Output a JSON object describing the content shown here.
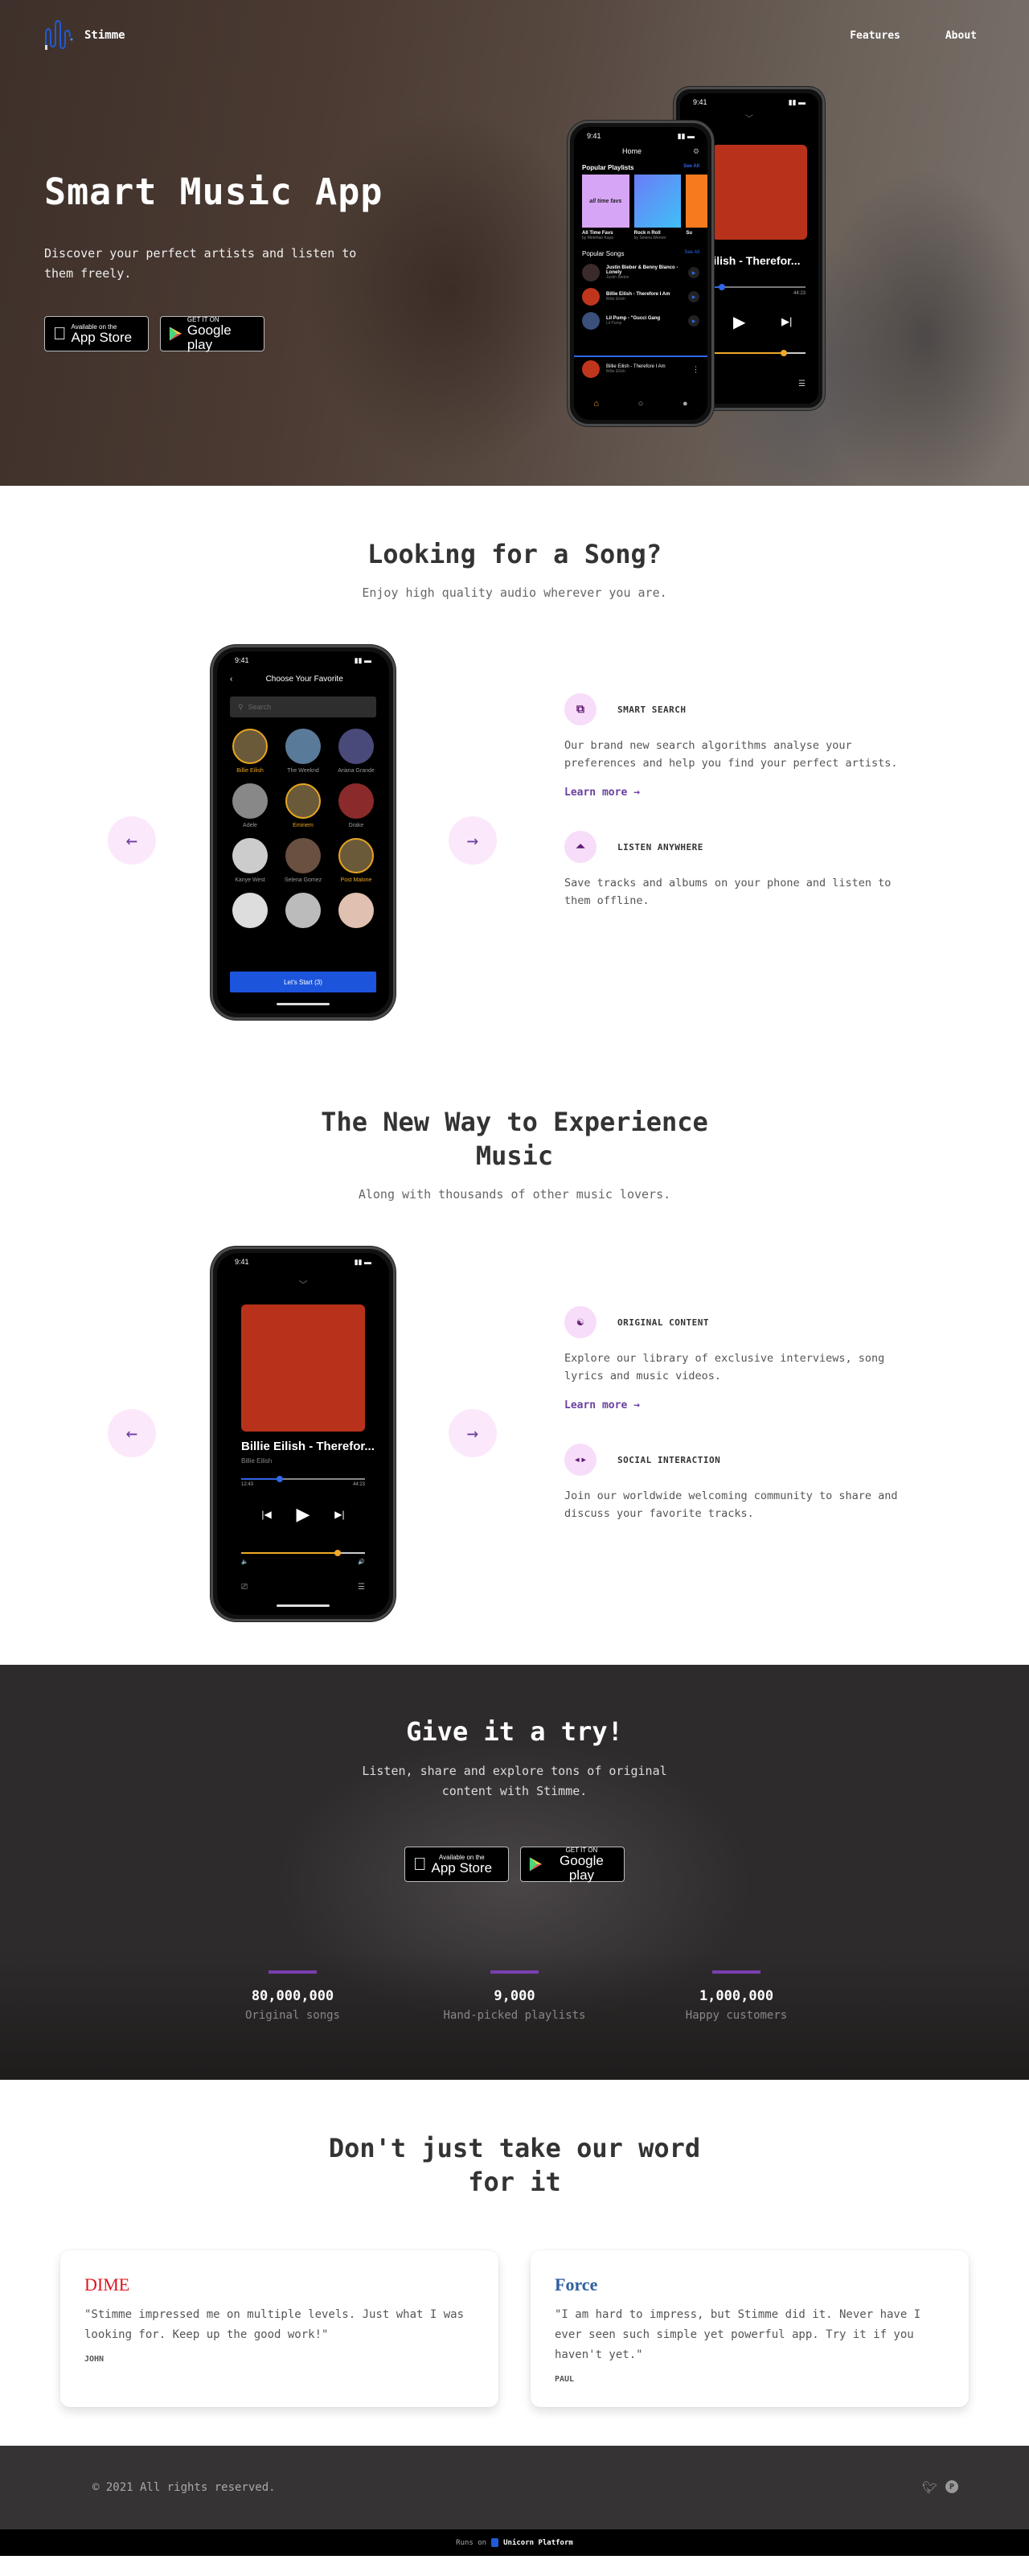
{
  "brand": {
    "name": "Stimme",
    "logo_icon": "sound-wave-icon",
    "accent": "#1e5bd8"
  },
  "nav": {
    "items": [
      {
        "label": "Features"
      },
      {
        "label": "About"
      }
    ]
  },
  "hero": {
    "title": "Smart Music App",
    "subtitle": "Discover your perfect artists and listen to them freely.",
    "appstore": {
      "small": "Available on the",
      "big": "App Store",
      "icon": "apple-icon"
    },
    "googleplay": {
      "small": "GET IT ON",
      "big": "Google play",
      "icon": "play-triangle-icon"
    },
    "phone_home": {
      "time": "9:41",
      "title": "Home",
      "playlists_heading": "Popular Playlists",
      "see_all": "See All",
      "playlists": [
        {
          "name": "All Time Favs",
          "by": "by Metehan Kaya",
          "cover_text": "all time favs",
          "color": "#d7a5f5"
        },
        {
          "name": "Rock n Roll",
          "by": "by Selena Werner",
          "color": "#3fa2f7"
        },
        {
          "name": "Su",
          "by": "by",
          "color": "#f77a1e"
        }
      ],
      "songs_heading": "Popular Songs",
      "songs": [
        {
          "title": "Justin Bieber & Benny Blanco - Lonely",
          "artist": "Justin Bieber"
        },
        {
          "title": "Billie Eilish - Therefore I Am",
          "artist": "Billie Eilish"
        },
        {
          "title": "Lil Pump - \"Gucci Gang",
          "artist": "Lil Pump"
        }
      ],
      "now_playing": {
        "title": "Billie Eilish - Therefore I Am",
        "artist": "Billie Eilish"
      }
    },
    "phone_player": {
      "time": "9:41",
      "title": "Eilish - Therefor...",
      "end_time": "44:23"
    }
  },
  "section1": {
    "title": "Looking for a Song?",
    "subtitle": "Enjoy high quality audio wherever you are.",
    "phone": {
      "time": "9:41",
      "header": "Choose Your Favorite",
      "search_placeholder": "Search",
      "artists": [
        {
          "name": "Billie Eilish",
          "selected": true
        },
        {
          "name": "The Weeknd",
          "selected": false
        },
        {
          "name": "Ariana Grande",
          "selected": false
        },
        {
          "name": "Adele",
          "selected": false
        },
        {
          "name": "Eminem",
          "selected": true
        },
        {
          "name": "Drake",
          "selected": false
        },
        {
          "name": "Kanye West",
          "selected": false
        },
        {
          "name": "Selena Gomez",
          "selected": false
        },
        {
          "name": "Post Malone",
          "selected": true
        },
        {
          "name": "",
          "selected": false
        },
        {
          "name": "",
          "selected": false
        },
        {
          "name": "",
          "selected": false
        }
      ],
      "start_button": "Let's Start (3)"
    },
    "features": [
      {
        "icon": "puzzle-icon",
        "title": "SMART SEARCH",
        "text": "Our brand new search algorithms analyse your preferences and help you find your perfect artists.",
        "link": "Learn more →"
      },
      {
        "icon": "double-chevron-up-icon",
        "title": "LISTEN ANYWHERE",
        "text": "Save tracks and albums on your phone and listen to them offline."
      }
    ]
  },
  "section2": {
    "title": "The New Way to Experience Music",
    "subtitle": "Along with thousands of other music lovers.",
    "phone": {
      "time": "9:41",
      "song_title": "Billie Eilish - Therefor...",
      "artist": "Billie Eilish",
      "elapsed": "12:43",
      "total": "44:23",
      "progress_fraction": 0.31,
      "volume_fraction": 0.78
    },
    "features": [
      {
        "icon": "yin-yang-icon",
        "title": "ORIGINAL CONTENT",
        "text": "Explore our library of exclusive interviews, song lyrics and music videos.",
        "link": "Learn more →"
      },
      {
        "icon": "diamond-arrows-icon",
        "title": "SOCIAL INTERACTION",
        "text": "Join our worldwide welcoming community to share and discuss your favorite tracks."
      }
    ]
  },
  "cta": {
    "title": "Give it a try!",
    "subtitle": "Listen, share and explore tons of original content with Stimme.",
    "appstore": {
      "small": "Available on the",
      "big": "App Store"
    },
    "googleplay": {
      "small": "GET IT ON",
      "big": "Google play"
    },
    "stats": [
      {
        "value": "80,000,000",
        "label": "Original songs"
      },
      {
        "value": "9,000",
        "label": "Hand-picked playlists"
      },
      {
        "value": "1,000,000",
        "label": "Happy customers"
      }
    ],
    "accent": "#7a3fb0"
  },
  "testimonials": {
    "title": "Don't just take our word for it",
    "items": [
      {
        "logo": "DIME",
        "logo_color": "#e0141e",
        "quote": "\"Stimme impressed me on multiple levels. Just what I was looking for. Keep up the good work!\"",
        "author": "JOHN"
      },
      {
        "logo": "Force",
        "logo_color": "#2f5f9e",
        "quote": "\"I am hard to impress, but Stimme did it. Never have I ever seen such simple yet powerful app. Try it if you haven't yet.\"",
        "author": "PAUL"
      }
    ]
  },
  "footer": {
    "copyright": "© 2021 All rights reserved.",
    "social": [
      {
        "icon": "twitter-icon"
      },
      {
        "icon": "pinterest-icon"
      }
    ],
    "runs_on": "Runs on",
    "platform": "Unicorn Platform"
  }
}
